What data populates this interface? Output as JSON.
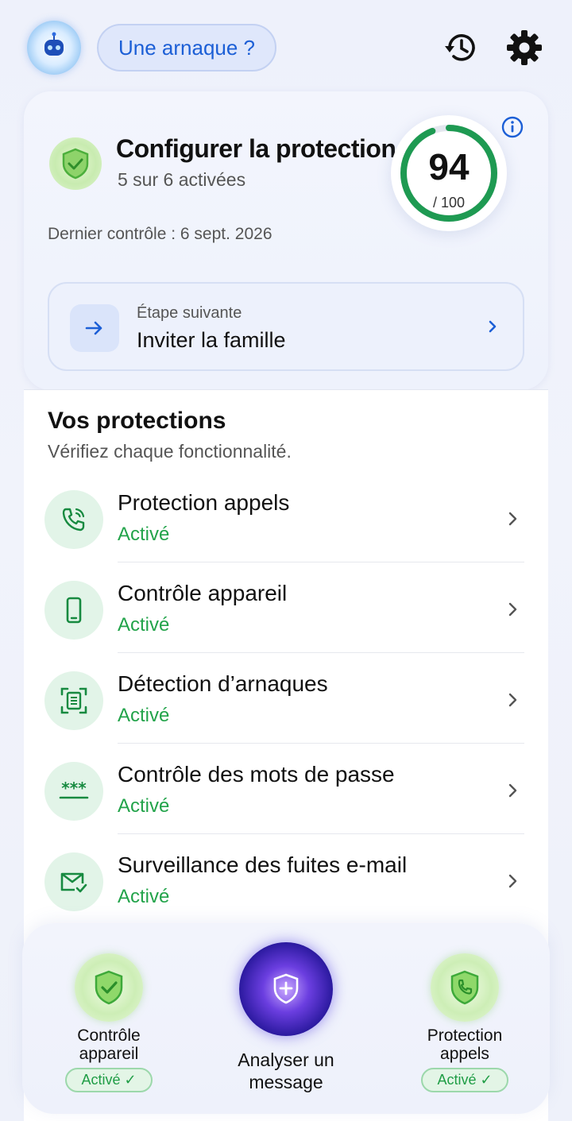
{
  "header": {
    "scam_chip": "Une arnaque ?",
    "avatar_icon": "robot-avatar-icon",
    "history_icon": "history-icon",
    "settings_icon": "gear-icon"
  },
  "summary": {
    "title": "Configurer la protection",
    "subtitle": "5 sur 6 activées",
    "last_check": "Dernier contrôle : 6 sept. 2026",
    "score": "94",
    "score_max": "/ 100",
    "score_fraction": 0.94,
    "next_step": {
      "label": "Étape suivante",
      "value": "Inviter la famille"
    }
  },
  "protections": {
    "title": "Vos protections",
    "subtitle": "Vérifiez chaque fonctionnalité.",
    "items": [
      {
        "title": "Protection appels",
        "status": "Activé",
        "icon": "phone-shield-icon"
      },
      {
        "title": "Contrôle appareil",
        "status": "Activé",
        "icon": "smartphone-icon"
      },
      {
        "title": "Détection d’arnaques",
        "status": "Activé",
        "icon": "scan-document-icon"
      },
      {
        "title": "Contrôle des mots de passe",
        "status": "Activé",
        "icon": "password-icon"
      },
      {
        "title": "Surveillance des fuites e-mail",
        "status": "Activé",
        "icon": "mail-check-icon"
      }
    ]
  },
  "quick_actions": {
    "left": {
      "label_line1": "Contrôle",
      "label_line2": "appareil",
      "status": "Activé ✓"
    },
    "center": {
      "label_line1": "Analyser un",
      "label_line2": "message"
    },
    "right": {
      "label_line1": "Protection",
      "label_line2": "appels",
      "status": "Activé ✓"
    }
  },
  "colors": {
    "accent_blue": "#1c5fd6",
    "success_green": "#22a34a",
    "ring_green": "#1e9a52"
  }
}
